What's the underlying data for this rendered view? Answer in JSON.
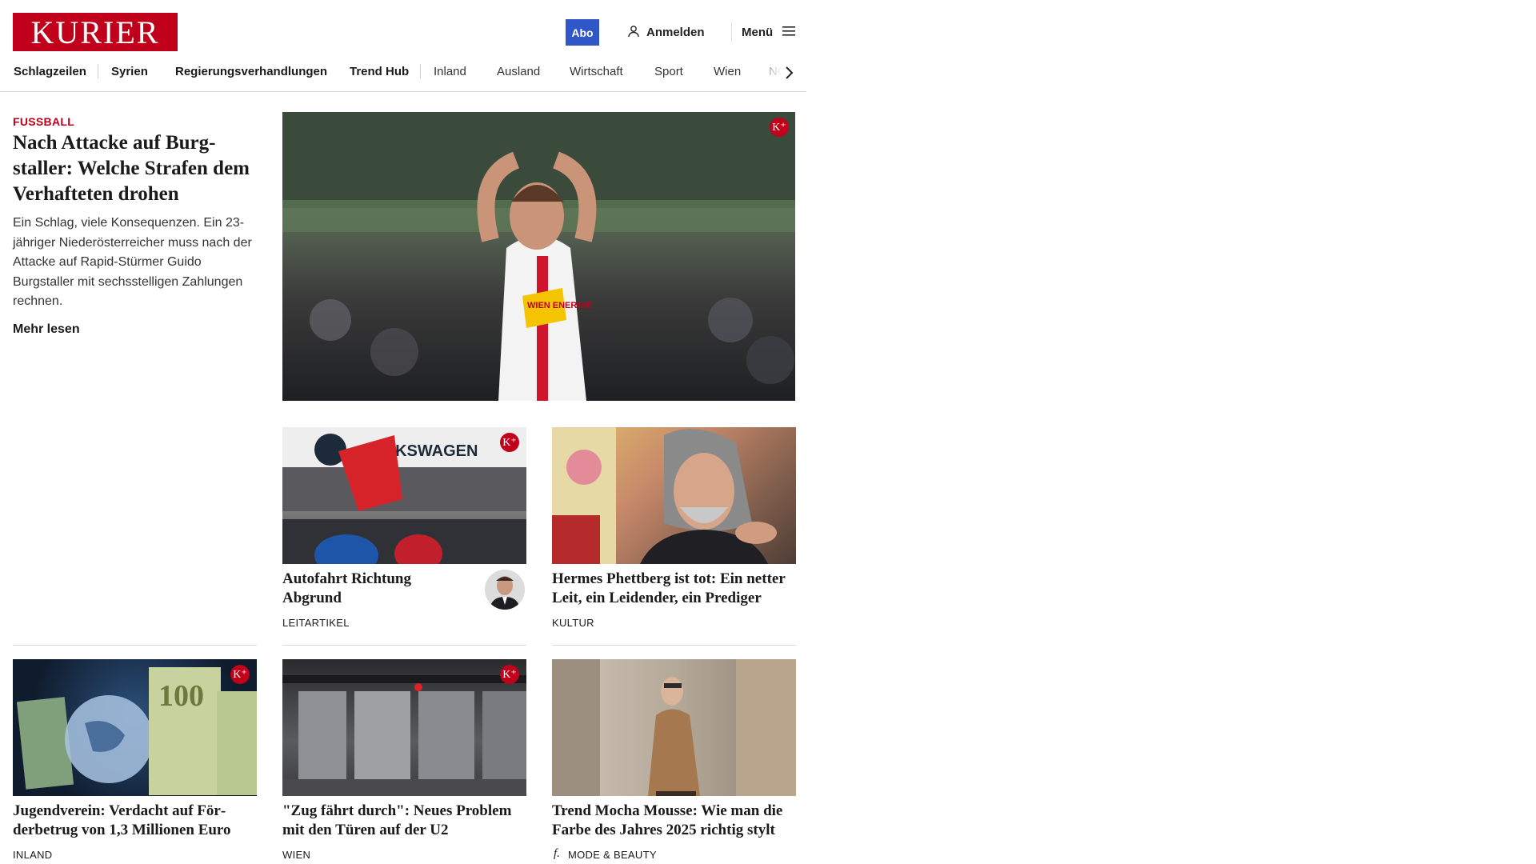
{
  "brand": {
    "logo": "KURIER",
    "accent": "#c0001b",
    "abo_color": "#2f57c7"
  },
  "header": {
    "abo_label": "Abo",
    "login_label": "Anmelden",
    "menu_label": "Menü",
    "icons": {
      "login": "user-icon",
      "menu": "hamburger-icon"
    }
  },
  "nav": {
    "items": [
      {
        "label": "Schlagzeilen"
      },
      {
        "label": "Syrien"
      },
      {
        "label": "Regierungsverhandlungen"
      },
      {
        "label": "Trend Hub"
      },
      {
        "label": "Inland"
      },
      {
        "label": "Ausland"
      },
      {
        "label": "Wirtschaft"
      },
      {
        "label": "Sport"
      },
      {
        "label": "Wien"
      },
      {
        "label": "NÖ"
      }
    ],
    "next_icon": "chevron-right-icon"
  },
  "lead": {
    "kicker": "FUSSBALL",
    "title": "Nach Attacke auf Burg­staller: Welche Strafen dem Verhafteten drohen",
    "text": "Ein Schlag, viele Konsequenzen. Ein 23-jähriger Niederösterreicher muss nach der Attacke auf Rapid-Stürmer Guido Burgstaller mit sechsstelligen Zahlungen rechnen.",
    "read_more": "Mehr lesen",
    "badge": "K⁺",
    "image_overlay_text": "WIEN ENERGIE"
  },
  "cards": [
    {
      "title": "Autofahrt Richtung Abgrund",
      "category": "LEITARTIKEL",
      "badge": "K⁺",
      "image_text": "VOLKSWAGEN"
    },
    {
      "title": "Hermes Phettberg ist tot: Ein netter Leit, ein Leidender, ein Prediger",
      "category": "KULTUR"
    },
    {
      "title": "Jugendverein: Verdacht auf För­derbetrug von 1,3 Millionen Euro",
      "category": "INLAND",
      "badge": "K⁺",
      "image_text": "100"
    },
    {
      "title": "\"Zug fährt durch\": Neues Problem mit den Türen auf der U2",
      "category": "WIEN",
      "badge": "K⁺"
    },
    {
      "title": "Trend Mocha Mousse: Wie man die Farbe des Jahres 2025 richtig stylt",
      "category": "MODE & BEAUTY",
      "category_icon": "f."
    }
  ]
}
